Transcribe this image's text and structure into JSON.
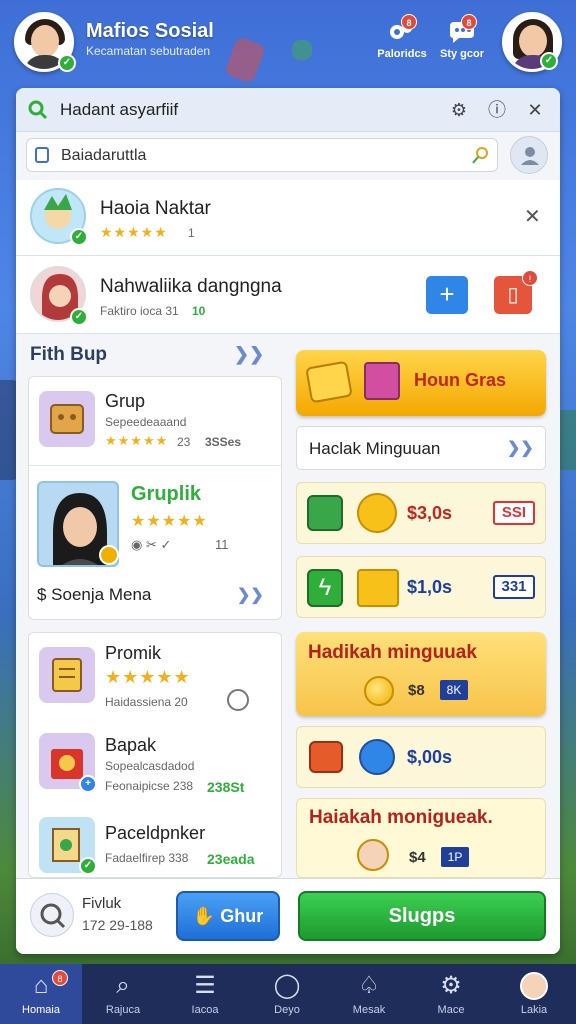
{
  "header": {
    "title": "Mafios Sosial",
    "subtitle": "Kecamatan sebutraden",
    "icons": [
      {
        "label": "Paloridcs",
        "badge": "8",
        "icon": "gear-group-icon"
      },
      {
        "label": "Sty gcor",
        "badge": "8",
        "icon": "chat-icon"
      }
    ]
  },
  "panel": {
    "title": "Hadant asyarfiif",
    "search_value": "Baiadaruttla",
    "friends": [
      {
        "name": "Haoia Naktar",
        "rating_text": "1"
      },
      {
        "name": "Nahwaliika dangngna",
        "sub": "Faktiro ioca 31",
        "sub_value": "10"
      }
    ],
    "section_title": "Fith Bup",
    "groups_top": [
      {
        "name": "Grup",
        "sub": "Sepeedeaaand",
        "rating": "23",
        "tag": "3SSes"
      },
      {
        "name": "Gruplik",
        "extra": "$ Soenja Mena",
        "nums": "11"
      }
    ],
    "groups_bottom": [
      {
        "name": "Promik",
        "sub": "Haidassiena 20"
      },
      {
        "name": "Bapak",
        "sub": "Sopealcasdadod",
        "sub2": "Feonaipicse 238",
        "value": "238St"
      },
      {
        "name": "Paceldpnker",
        "sub": "Fadaelfirep 338",
        "value": "23eada"
      }
    ],
    "right": {
      "gold_button": "Houn Gras",
      "label_button": "Haclak Minguuan",
      "offers": [
        {
          "amount": "$3,0s",
          "price": "SSI"
        },
        {
          "amount": "$1,0s",
          "price": "331"
        }
      ],
      "weekly_title": "Hadikah minguuak",
      "weekly_amount": "$8",
      "weekly_tag": "8K",
      "offer3_amount": "$,00s",
      "weekly2_title": "Haiakah monigueak.",
      "weekly2_amount": "$4",
      "weekly2_tag": "1P"
    },
    "bottom": {
      "search_label": "Fivluk",
      "search_value": "172 29-188",
      "blue_button": "Ghur",
      "green_button": "Slugps"
    }
  },
  "navbar": {
    "items": [
      {
        "label": "Homaia",
        "icon": "home-icon",
        "badge": "8"
      },
      {
        "label": "Rajuca",
        "icon": "search-icon"
      },
      {
        "label": "Iacoa",
        "icon": "list-icon"
      },
      {
        "label": "Deyo",
        "icon": "chat-bubble-icon"
      },
      {
        "label": "Mesak",
        "icon": "bell-icon"
      },
      {
        "label": "Mace",
        "icon": "settings-icon"
      },
      {
        "label": "Lakia",
        "icon": "profile-icon"
      }
    ]
  }
}
